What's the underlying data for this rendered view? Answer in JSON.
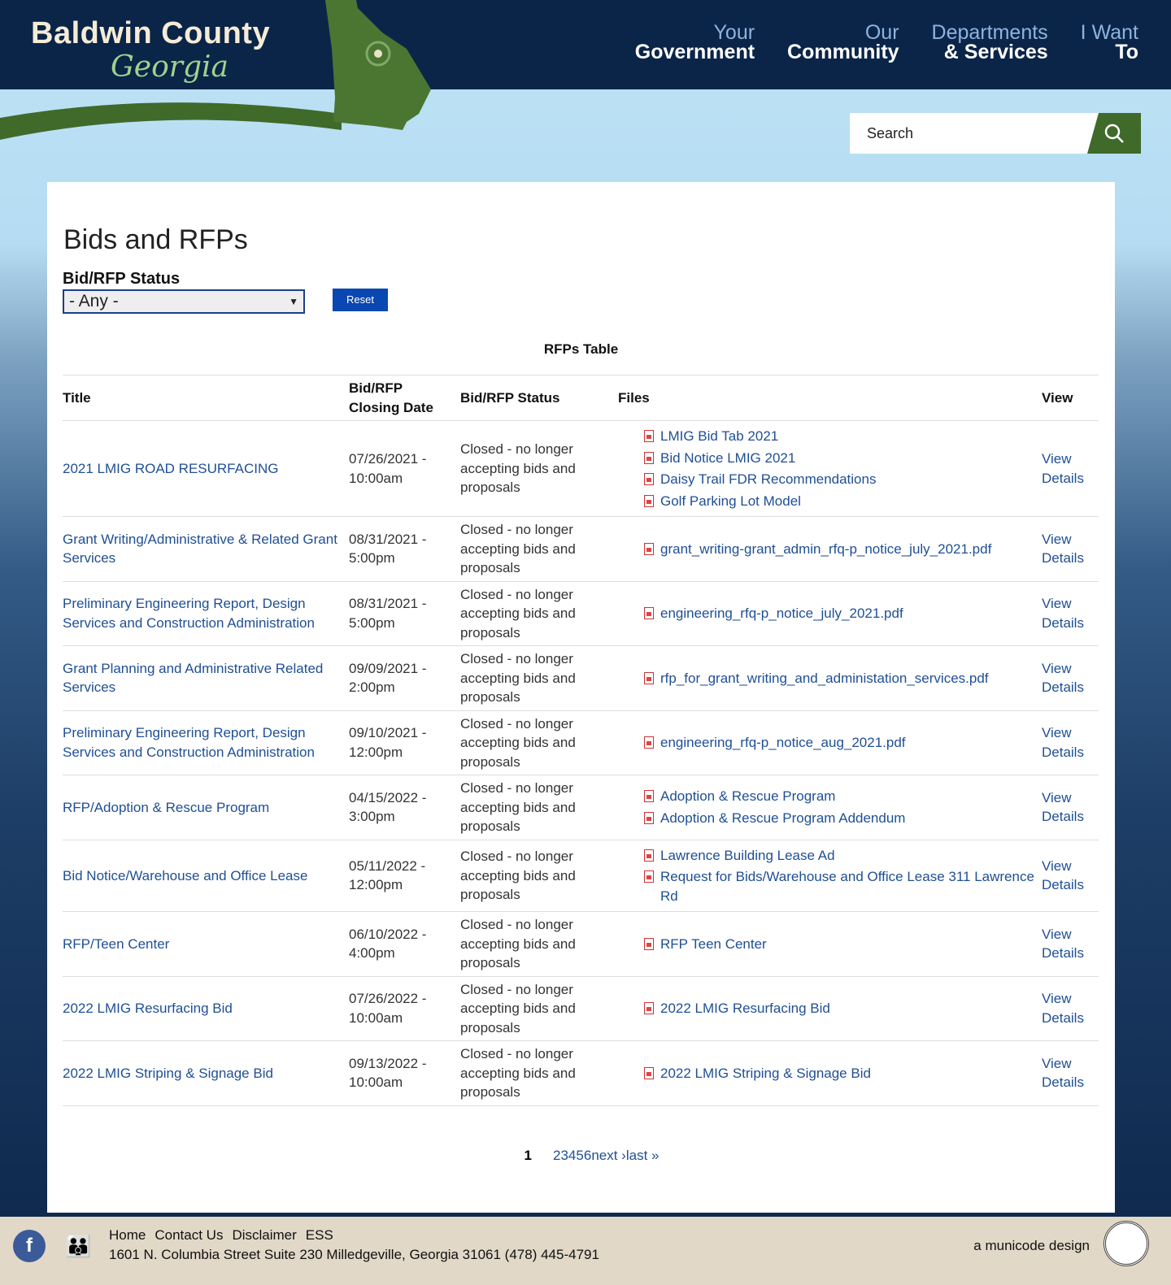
{
  "header": {
    "logo_line1": "Baldwin County",
    "logo_line2": "Georgia",
    "nav": [
      {
        "a": "Your",
        "b": "Government"
      },
      {
        "a": "Our",
        "b": "Community"
      },
      {
        "a": "Departments",
        "b": "& Services"
      },
      {
        "a": "I Want",
        "b": "To"
      }
    ],
    "search_placeholder": "Search"
  },
  "page": {
    "title": "Bids and RFPs",
    "filter_label": "Bid/RFP Status",
    "filter_value": "- Any -",
    "reset_label": "Reset",
    "table_caption": "RFPs Table"
  },
  "table": {
    "headers": [
      "Title",
      "Bid/RFP Closing Date",
      "Bid/RFP Status",
      "Files",
      "View"
    ],
    "rows": [
      {
        "title": "2021 LMIG ROAD RESURFACING",
        "date": "07/26/2021 - 10:00am",
        "status": "Closed - no longer accepting bids and proposals",
        "files": [
          "LMIG Bid Tab 2021",
          "Bid Notice LMIG 2021",
          "Daisy Trail FDR Recommendations",
          "Golf Parking Lot Model"
        ],
        "view": "View Details"
      },
      {
        "title": "Grant Writing/Administrative & Related Grant Services",
        "date": "08/31/2021 - 5:00pm",
        "status": "Closed - no longer accepting bids and proposals",
        "files": [
          "grant_writing-grant_admin_rfq-p_notice_july_2021.pdf"
        ],
        "view": "View Details"
      },
      {
        "title": "Preliminary Engineering Report, Design Services and Construction Administration",
        "date": "08/31/2021 - 5:00pm",
        "status": "Closed - no longer accepting bids and proposals",
        "files": [
          "engineering_rfq-p_notice_july_2021.pdf"
        ],
        "view": "View Details"
      },
      {
        "title": "Grant Planning and Administrative Related Services",
        "date": "09/09/2021 - 2:00pm",
        "status": "Closed - no longer accepting bids and proposals",
        "files": [
          "rfp_for_grant_writing_and_administation_services.pdf"
        ],
        "view": "View Details"
      },
      {
        "title": "Preliminary Engineering Report, Design Services and Construction Administration",
        "date": "09/10/2021 - 12:00pm",
        "status": "Closed - no longer accepting bids and proposals",
        "files": [
          "engineering_rfq-p_notice_aug_2021.pdf"
        ],
        "view": "View Details"
      },
      {
        "title": "RFP/Adoption & Rescue Program",
        "date": "04/15/2022 - 3:00pm",
        "status": "Closed - no longer accepting bids and proposals",
        "files": [
          "Adoption & Rescue Program",
          "Adoption & Rescue Program Addendum"
        ],
        "view": "View Details"
      },
      {
        "title": "Bid Notice/Warehouse and Office Lease",
        "date": "05/11/2022 - 12:00pm",
        "status": "Closed - no longer accepting bids and proposals",
        "files": [
          "Lawrence Building Lease Ad",
          "Request for Bids/Warehouse and Office Lease 311 Lawrence Rd"
        ],
        "view": "View Details"
      },
      {
        "title": "RFP/Teen Center",
        "date": "06/10/2022 - 4:00pm",
        "status": "Closed - no longer accepting bids and proposals",
        "files": [
          "RFP Teen Center"
        ],
        "view": "View Details"
      },
      {
        "title": "2022 LMIG Resurfacing Bid",
        "date": "07/26/2022 - 10:00am",
        "status": "Closed - no longer accepting bids and proposals",
        "files": [
          "2022 LMIG Resurfacing Bid"
        ],
        "view": "View Details"
      },
      {
        "title": "2022 LMIG Striping & Signage Bid",
        "date": "09/13/2022 - 10:00am",
        "status": "Closed - no longer accepting bids and proposals",
        "files": [
          "2022 LMIG Striping & Signage Bid"
        ],
        "view": "View Details"
      }
    ]
  },
  "pager": [
    "1",
    "2",
    "3",
    "4",
    "5",
    "6",
    "next ›",
    "last »"
  ],
  "footer": {
    "links": [
      "Home",
      "Contact Us",
      "Disclaimer",
      "ESS"
    ],
    "address": "1601 N. Columbia Street Suite 230 Milledgeville, Georgia 31061 (478) 445-4791",
    "credit": "a municode design"
  }
}
